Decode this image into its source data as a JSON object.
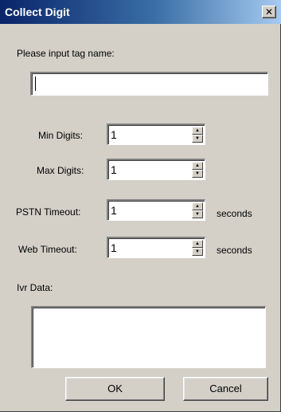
{
  "window": {
    "title": "Collect Digit",
    "close_glyph": "✕",
    "close_icon": "close-icon"
  },
  "form": {
    "tag_prompt": "Please input tag name:",
    "tag_value": "",
    "min_digits_label": "Min Digits:",
    "min_digits_value": "1",
    "max_digits_label": "Max Digits:",
    "max_digits_value": "1",
    "pstn_timeout_label": "PSTN Timeout:",
    "pstn_timeout_value": "1",
    "pstn_timeout_unit": "seconds",
    "web_timeout_label": "Web Timeout:",
    "web_timeout_value": "1",
    "web_timeout_unit": "seconds",
    "ivr_data_label": "Ivr Data:",
    "ivr_data_value": ""
  },
  "buttons": {
    "ok_label": "OK",
    "cancel_label": "Cancel"
  },
  "spinner_icons": {
    "up": "▲",
    "down": "▼"
  },
  "colors": {
    "dialog_bg": "#d4d0c8",
    "title_start": "#0a246a",
    "title_end": "#a6caf0"
  }
}
